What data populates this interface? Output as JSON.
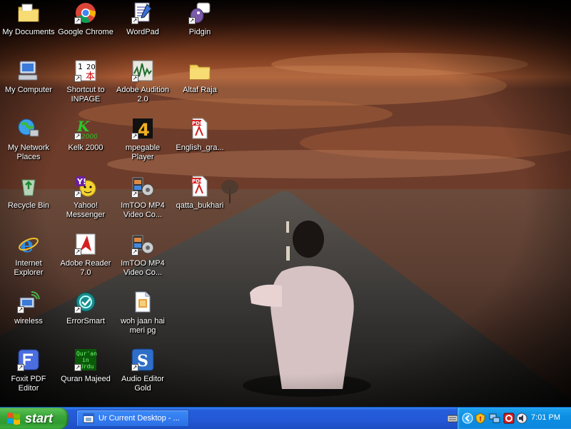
{
  "desktop": {
    "icons": [
      {
        "label": "My Documents"
      },
      {
        "label": "Google Chrome"
      },
      {
        "label": "WordPad"
      },
      {
        "label": "Pidgin"
      },
      {
        "label": "My Computer"
      },
      {
        "label": "Shortcut to INPAGE"
      },
      {
        "label": "Adobe Audition 2.0"
      },
      {
        "label": "Altaf Raja"
      },
      {
        "label": "My Network Places"
      },
      {
        "label": "Kelk 2000"
      },
      {
        "label": "mpegable Player"
      },
      {
        "label": "English_gra..."
      },
      {
        "label": "Recycle Bin"
      },
      {
        "label": "Yahoo! Messenger"
      },
      {
        "label": "ImTOO MP4 Video Co..."
      },
      {
        "label": "qatta_bukhari"
      },
      {
        "label": "Internet Explorer"
      },
      {
        "label": "Adobe Reader 7.0"
      },
      {
        "label": "ImTOO MP4 Video Co..."
      },
      {
        "label": "wireless"
      },
      {
        "label": "ErrorSmart"
      },
      {
        "label": "woh jaan hai meri pg"
      },
      {
        "label": "Foxit PDF Editor"
      },
      {
        "label": "Quran Majeed"
      },
      {
        "label": "Audio Editor Gold"
      }
    ],
    "icon_glyphs": {
      "inpage_text": "1 2 0 本",
      "kelk_text": "K 2000",
      "quran_text": "Qur'an in Urdu",
      "pdf_text": "PDF"
    }
  },
  "taskbar": {
    "start_label": "start",
    "task_label": "Ur Current Desktop - ...",
    "clock": "7:01 PM"
  },
  "colors": {
    "taskbar_blue": "#245edb",
    "start_green": "#3aa63a",
    "tray_blue": "#0d8fe3"
  }
}
